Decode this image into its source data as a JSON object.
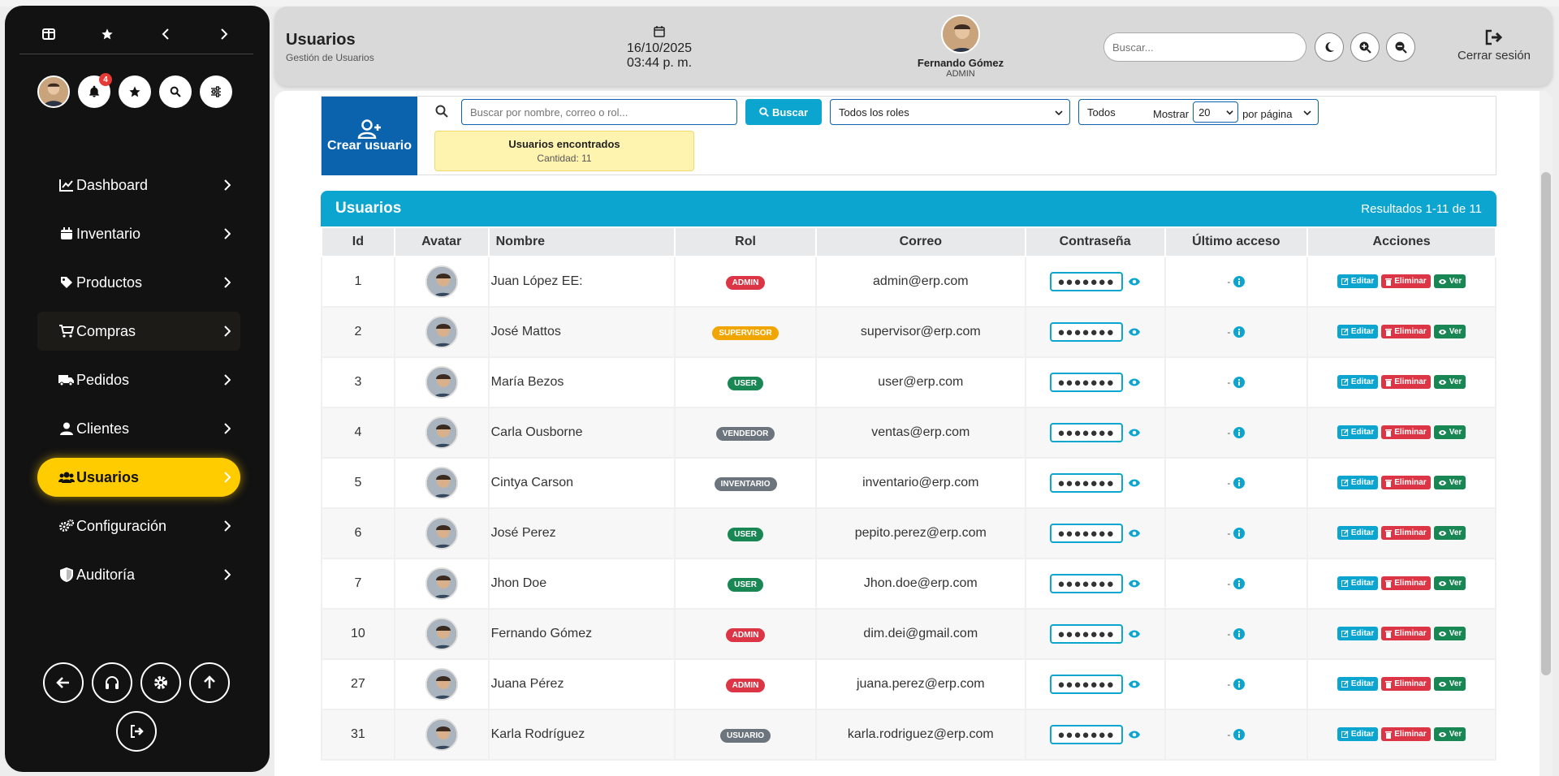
{
  "colors": {
    "brand": "#0b63ad",
    "accent": "#0ba5cf",
    "active": "#ffcc00",
    "danger": "#dc3545",
    "success": "#198754"
  },
  "sidebar": {
    "notif_count": "4",
    "items": [
      {
        "label": "Dashboard",
        "icon": "chart-line-icon"
      },
      {
        "label": "Inventario",
        "icon": "calendar-box-icon"
      },
      {
        "label": "Productos",
        "icon": "tag-icon"
      },
      {
        "label": "Compras",
        "icon": "cart-icon"
      },
      {
        "label": "Pedidos",
        "icon": "truck-icon"
      },
      {
        "label": "Clientes",
        "icon": "user-icon"
      },
      {
        "label": "Usuarios",
        "icon": "users-icon"
      },
      {
        "label": "Configuración",
        "icon": "gears-icon"
      },
      {
        "label": "Auditoría",
        "icon": "shield-icon"
      }
    ]
  },
  "header": {
    "title": "Usuarios",
    "subtitle": "Gestión de Usuarios",
    "date": "16/10/2025",
    "time": "03:44 p. m.",
    "user_name": "Fernando Gómez",
    "user_role": "ADMIN",
    "search_placeholder": "Buscar...",
    "logout_label": "Cerrar sesión"
  },
  "toolbar": {
    "create_label": "Crear usuario",
    "search_placeholder": "Buscar por nombre, correo o rol...",
    "search_button": "Buscar",
    "roles_select": "Todos los roles",
    "status_select": "Todos",
    "show_label": "Mostrar",
    "per_page_value": "20",
    "per_page_suffix": "por página",
    "found_title": "Usuarios encontrados",
    "found_count": "Cantidad: 11"
  },
  "table": {
    "title": "Usuarios",
    "results": "Resultados 1-11 de 11",
    "columns": [
      "Id",
      "Avatar",
      "Nombre",
      "Rol",
      "Correo",
      "Contraseña",
      "Último acceso",
      "Acciones"
    ],
    "password_mask": "●●●●●●●",
    "last_access": "-",
    "actions": {
      "edit": "Editar",
      "delete": "Eliminar",
      "view": "Ver"
    },
    "rows": [
      {
        "id": "1",
        "name": "Juan López EE:",
        "role": "ADMIN",
        "role_color": "#dc3545",
        "email": "admin@erp.com"
      },
      {
        "id": "2",
        "name": "José Mattos",
        "role": "SUPERVISOR",
        "role_color": "#f0a500",
        "email": "supervisor@erp.com"
      },
      {
        "id": "3",
        "name": "María Bezos",
        "role": "USER",
        "role_color": "#198754",
        "email": "user@erp.com"
      },
      {
        "id": "4",
        "name": "Carla Ousborne",
        "role": "VENDEDOR",
        "role_color": "#6c757d",
        "email": "ventas@erp.com"
      },
      {
        "id": "5",
        "name": "Cintya Carson",
        "role": "INVENTARIO",
        "role_color": "#6c757d",
        "email": "inventario@erp.com"
      },
      {
        "id": "6",
        "name": "José Perez",
        "role": "USER",
        "role_color": "#198754",
        "email": "pepito.perez@erp.com"
      },
      {
        "id": "7",
        "name": "Jhon Doe",
        "role": "USER",
        "role_color": "#198754",
        "email": "Jhon.doe@erp.com"
      },
      {
        "id": "10",
        "name": "Fernando Gómez",
        "role": "ADMIN",
        "role_color": "#dc3545",
        "email": "dim.dei@gmail.com"
      },
      {
        "id": "27",
        "name": "Juana Pérez",
        "role": "ADMIN",
        "role_color": "#dc3545",
        "email": "juana.perez@erp.com"
      },
      {
        "id": "31",
        "name": "Karla Rodríguez",
        "role": "USUARIO",
        "role_color": "#6c757d",
        "email": "karla.rodriguez@erp.com"
      }
    ]
  }
}
